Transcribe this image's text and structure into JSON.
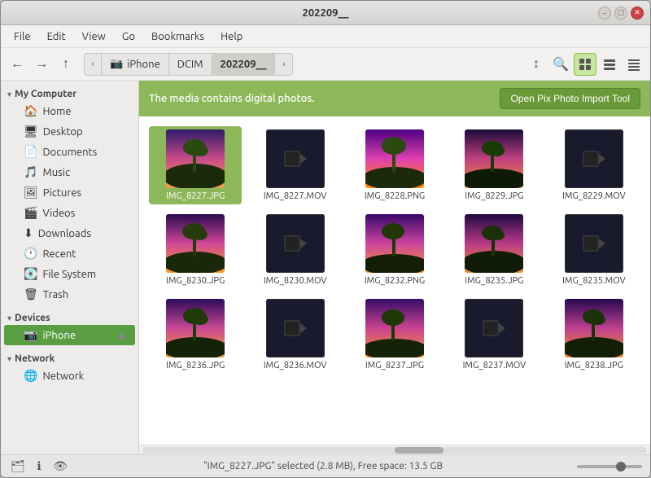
{
  "window": {
    "title": "202209__",
    "controls": {
      "minimize": "–",
      "maximize": "□",
      "close": "✕"
    }
  },
  "menubar": {
    "items": [
      "File",
      "Edit",
      "View",
      "Go",
      "Bookmarks",
      "Help"
    ]
  },
  "toolbar": {
    "back_label": "←",
    "forward_label": "→",
    "up_label": "↑",
    "breadcrumb": [
      {
        "label": "iPhone",
        "icon": "📷",
        "id": "iphone"
      },
      {
        "label": "DCIM",
        "icon": "",
        "id": "dcim"
      },
      {
        "label": "202209__",
        "icon": "",
        "id": "current"
      }
    ],
    "search_icon": "🔍",
    "view_grid": "▦",
    "view_list": "☰",
    "view_compact": "⊟",
    "sort_icon": "↕"
  },
  "notification": {
    "text": "The media contains digital photos.",
    "button_label": "Open Pix Photo Import Tool"
  },
  "sidebar": {
    "sections": [
      {
        "id": "my-computer",
        "label": "My Computer",
        "expanded": true,
        "items": [
          {
            "id": "home",
            "label": "Home",
            "icon": "🏠"
          },
          {
            "id": "desktop",
            "label": "Desktop",
            "icon": "🖥"
          },
          {
            "id": "documents",
            "label": "Documents",
            "icon": "📄"
          },
          {
            "id": "music",
            "label": "Music",
            "icon": "🎵"
          },
          {
            "id": "pictures",
            "label": "Pictures",
            "icon": "🖼"
          },
          {
            "id": "videos",
            "label": "Videos",
            "icon": "🎬"
          },
          {
            "id": "downloads",
            "label": "Downloads",
            "icon": "⬇"
          },
          {
            "id": "recent",
            "label": "Recent",
            "icon": "🕐"
          },
          {
            "id": "filesystem",
            "label": "File System",
            "icon": "💽"
          },
          {
            "id": "trash",
            "label": "Trash",
            "icon": "🗑"
          }
        ]
      },
      {
        "id": "devices",
        "label": "Devices",
        "expanded": true,
        "items": [
          {
            "id": "iphone",
            "label": "iPhone",
            "icon": "📷",
            "eject": true
          }
        ]
      },
      {
        "id": "network",
        "label": "Network",
        "expanded": true,
        "items": [
          {
            "id": "network",
            "label": "Network",
            "icon": "🌐"
          }
        ]
      }
    ]
  },
  "files": [
    {
      "name": "IMG_8227.JPG",
      "type": "photo",
      "selected": true
    },
    {
      "name": "IMG_8227.MOV",
      "type": "video",
      "selected": false
    },
    {
      "name": "IMG_8228.PNG",
      "type": "photo",
      "selected": false
    },
    {
      "name": "IMG_8229.JPG",
      "type": "photo",
      "selected": false
    },
    {
      "name": "IMG_8229.MOV",
      "type": "video",
      "selected": false
    },
    {
      "name": "IMG_8230.JPG",
      "type": "photo",
      "selected": false
    },
    {
      "name": "IMG_8230.MOV",
      "type": "video",
      "selected": false
    },
    {
      "name": "IMG_8232.PNG",
      "type": "photo",
      "selected": false
    },
    {
      "name": "IMG_8235.JPG",
      "type": "photo",
      "selected": false
    },
    {
      "name": "IMG_8235.MOV",
      "type": "video",
      "selected": false
    },
    {
      "name": "IMG_8236.JPG",
      "type": "photo",
      "selected": false
    },
    {
      "name": "IMG_8236.MOV",
      "type": "video",
      "selected": false
    },
    {
      "name": "IMG_8237.JPG",
      "type": "photo",
      "selected": false
    },
    {
      "name": "IMG_8237.MOV",
      "type": "video",
      "selected": false
    },
    {
      "name": "IMG_8238.JPG",
      "type": "photo",
      "selected": false
    }
  ],
  "statusbar": {
    "text": "\"IMG_8227.JPG\" selected (2.8 MB), Free space: 13.5 GB"
  }
}
